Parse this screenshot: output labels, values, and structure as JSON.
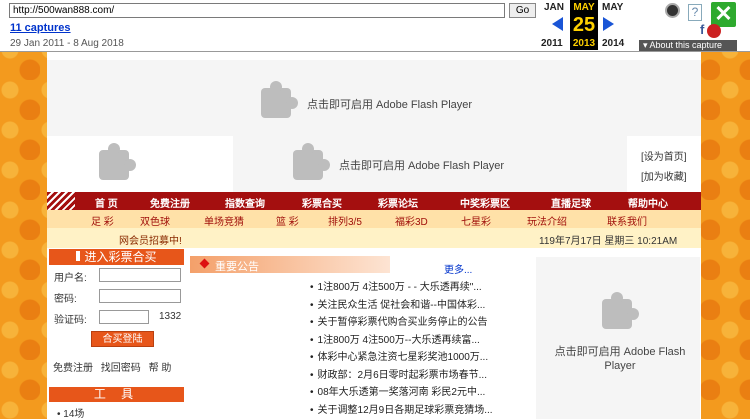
{
  "wayback": {
    "url": "http://500wan888.com/",
    "go_label": "Go",
    "captures_label": "11 captures",
    "date_range": "29 Jan 2011 - 8 Aug 2018",
    "prev_month": "JAN",
    "current_month": "MAY",
    "next_month": "MAY",
    "current_day": "25",
    "prev_year": "2011",
    "current_year": "2013",
    "next_year": "2014",
    "about_label": "▾ About this capture",
    "close_label": "✕",
    "help_label": "?",
    "fb_label": "f"
  },
  "flash": {
    "message": "点击即可启用 Adobe Flash Player"
  },
  "util_links": [
    "[设为首页]",
    "[加为收藏]"
  ],
  "nav_main": [
    "首 页",
    "免费注册",
    "指数查询",
    "彩票合买",
    "彩票论坛",
    "中奖彩票区",
    "直播足球",
    "帮助中心"
  ],
  "nav_sub": [
    "足 彩",
    "双色球",
    "单场竞猜",
    "篮 彩",
    "排列3/5",
    "福彩3D",
    "七星彩",
    "玩法介绍",
    "联系我们"
  ],
  "ticker": {
    "left_text": "网会员招募中!",
    "right_text": "119年7月17日 星期三 10:21AM"
  },
  "login": {
    "title": "进入彩票合买",
    "username_label": "用户名:",
    "password_label": "密码:",
    "code_label": "验证码:",
    "code_value": "1332",
    "submit_label": "合买登陆",
    "register_link": "免费注册",
    "recover_link": "找回密码",
    "help_link": "帮 助"
  },
  "tools": {
    "title": "工 具",
    "first_item": "• 14场"
  },
  "announcements": {
    "title": "重要公告",
    "more_label": "更多...",
    "items": [
      "1注800万 4注500万 - - 大乐透再续\"...",
      "关注民众生活 促社会和谐--中国体彩...",
      "关于暂停彩票代购合买业务停止的公告",
      "1注800万 4注500万--大乐透再续富...",
      "体彩中心紧急注资七星彩奖池1000万...",
      "财政部：2月6日零时起彩票市场春节...",
      "08年大乐透第一奖落河南 彩民2元中...",
      "关于调整12月9日各期足球彩票竞猜场..."
    ]
  }
}
